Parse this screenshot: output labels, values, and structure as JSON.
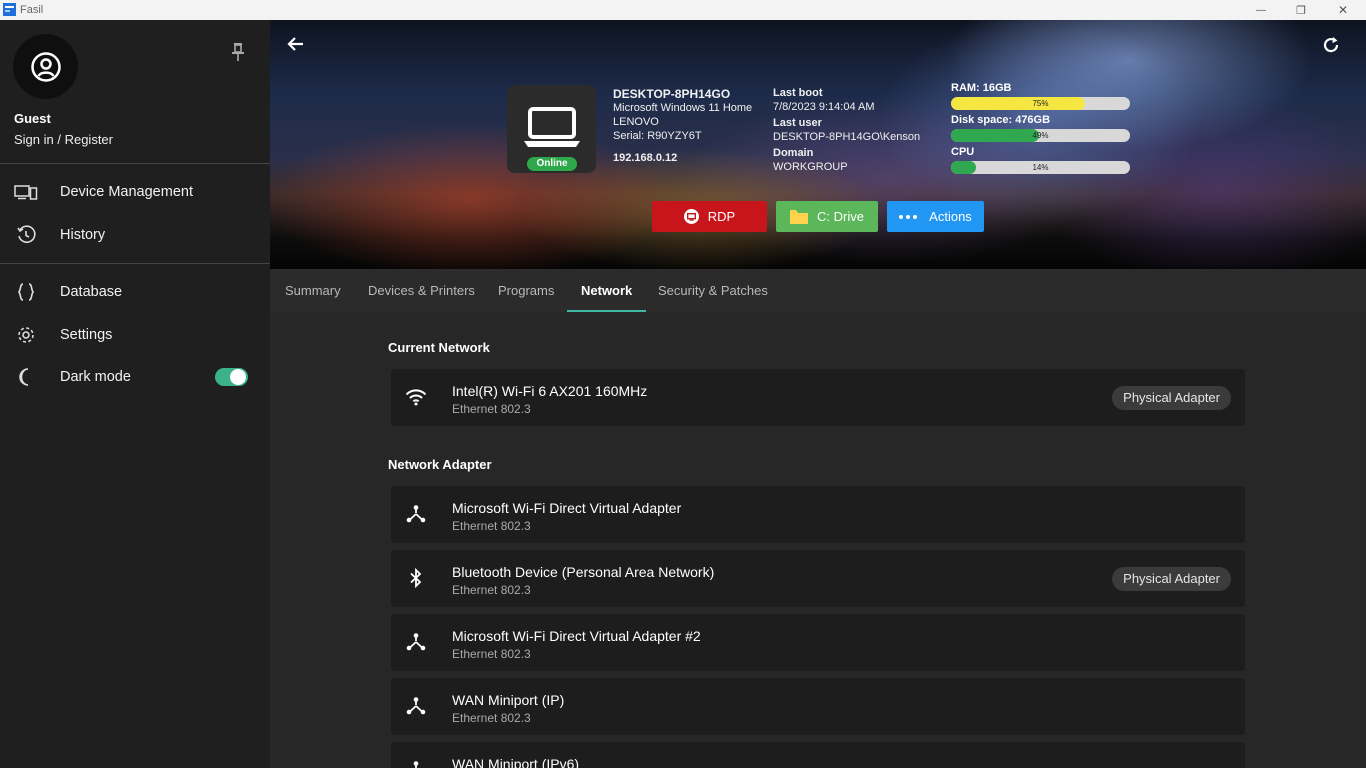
{
  "window": {
    "title": "Fasil",
    "minimize_glyph": "—",
    "maximize_glyph": "❐",
    "close_glyph": "✕"
  },
  "sidebar": {
    "user_name": "Guest",
    "sign_in": "Sign in / Register",
    "items": [
      {
        "label": "Device Management",
        "icon": "devices-icon"
      },
      {
        "label": "History",
        "icon": "history-icon"
      },
      {
        "label": "Database",
        "icon": "braces-icon"
      },
      {
        "label": "Settings",
        "icon": "gear-icon"
      },
      {
        "label": "Dark mode",
        "icon": "moon-icon"
      }
    ],
    "dark_mode_on": true
  },
  "device": {
    "name": "DESKTOP-8PH14GO",
    "os": "Microsoft Windows 11 Home",
    "manufacturer": "LENOVO",
    "serial": "Serial: R90YZY6T",
    "ip": "192.168.0.12",
    "status": "Online",
    "last_boot_label": "Last boot",
    "last_boot": "7/8/2023 9:14:04 AM",
    "last_user_label": "Last user",
    "last_user": "DESKTOP-8PH14GO\\Kenson",
    "domain_label": "Domain",
    "domain": "WORKGROUP"
  },
  "meters": {
    "ram": {
      "label": "RAM: 16GB",
      "percent": 75,
      "pct_label": "75%",
      "color": "#f5e642"
    },
    "disk": {
      "label": "Disk space: 476GB",
      "percent": 49,
      "pct_label": "49%",
      "color": "#2fa84f"
    },
    "cpu": {
      "label": "CPU",
      "percent": 14,
      "pct_label": "14%",
      "color": "#2fa84f"
    }
  },
  "actions": {
    "rdp": {
      "label": "RDP",
      "color": "#c8151b"
    },
    "drive": {
      "label": "C: Drive",
      "color": "#5bb75a"
    },
    "more": {
      "label": "Actions",
      "color": "#2196f3"
    }
  },
  "tabs": [
    "Summary",
    "Devices & Printers",
    "Programs",
    "Network",
    "Security & Patches"
  ],
  "active_tab": "Network",
  "current_network": {
    "title": "Current Network",
    "adapters": [
      {
        "name": "Intel(R) Wi-Fi 6 AX201 160MHz",
        "type": "Ethernet 802.3",
        "badge": "Physical Adapter",
        "icon": "wifi-icon"
      }
    ]
  },
  "network_adapter": {
    "title": "Network Adapter",
    "adapters": [
      {
        "name": "Microsoft Wi-Fi Direct Virtual Adapter",
        "type": "Ethernet 802.3",
        "badge": "",
        "icon": "network-icon"
      },
      {
        "name": "Bluetooth Device (Personal Area Network)",
        "type": "Ethernet 802.3",
        "badge": "Physical Adapter",
        "icon": "bluetooth-icon"
      },
      {
        "name": "Microsoft Wi-Fi Direct Virtual Adapter #2",
        "type": "Ethernet 802.3",
        "badge": "",
        "icon": "network-icon"
      },
      {
        "name": "WAN Miniport (IP)",
        "type": "Ethernet 802.3",
        "badge": "",
        "icon": "network-icon"
      },
      {
        "name": "WAN Miniport (IPv6)",
        "type": "",
        "badge": "",
        "icon": "network-icon"
      }
    ]
  }
}
